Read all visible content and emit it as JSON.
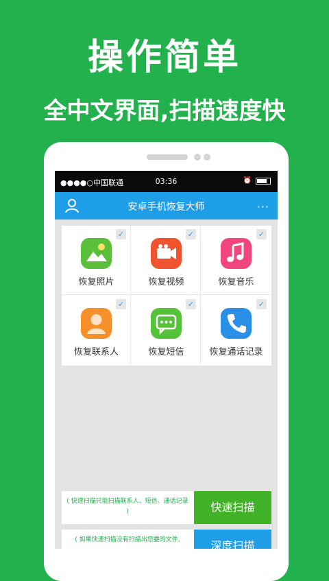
{
  "promo": {
    "headline": "操作简单",
    "subheadline": "全中文界面,扫描速度快"
  },
  "statusbar": {
    "carrier": "●●●●○中国联通",
    "time": "03:36"
  },
  "appbar": {
    "title": "安卓手机恢复大师",
    "user_icon": "user-icon",
    "more_icon": "more-icon",
    "more_glyph": "···"
  },
  "items": [
    {
      "label": "恢复照片",
      "icon": "photo-icon",
      "color": "#5bbf3b"
    },
    {
      "label": "恢复视频",
      "icon": "video-icon",
      "color": "#f2532f"
    },
    {
      "label": "恢复音乐",
      "icon": "music-icon",
      "color": "#f0457d"
    },
    {
      "label": "恢复联系人",
      "icon": "contact-icon",
      "color": "#f6902a"
    },
    {
      "label": "恢复短信",
      "icon": "sms-icon",
      "color": "#55c23a"
    },
    {
      "label": "恢复通话记录",
      "icon": "phone-icon",
      "color": "#2a8fe6"
    }
  ],
  "check_glyph": "✓",
  "quick_scan": {
    "hint": "( 快速扫描只能扫描联系人、短信、通话记录 )",
    "button": "快速扫描",
    "color": "#41b128"
  },
  "deep_scan": {
    "hint": "( 如果快速扫描没有扫描出您要的文件,",
    "button": "深度扫描",
    "color": "#1f9ee8"
  }
}
